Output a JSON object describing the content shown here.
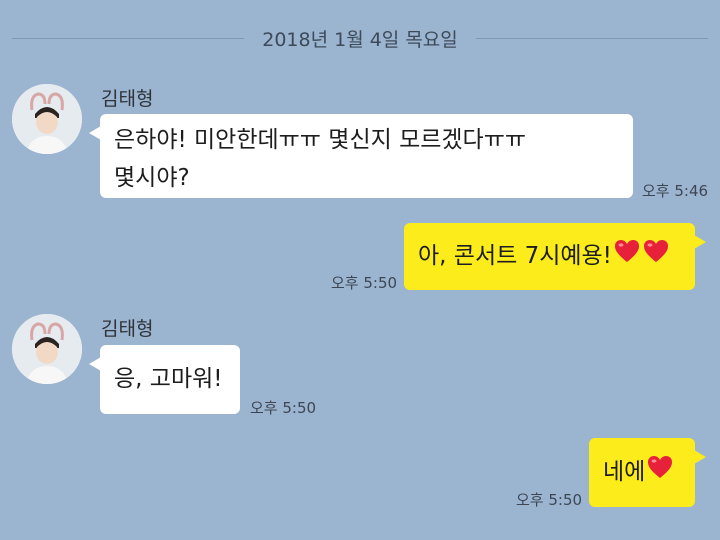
{
  "date_divider": "2018년 1월 4일 목요일",
  "messages": [
    {
      "sender": "김태형",
      "line1": "은하야! 미안한데ㅠㅠ 몇신지 모르겠다ㅠㅠ",
      "line2": "몇시야?",
      "time": "오후 5:46"
    },
    {
      "text": "아, 콘서트 7시예용!",
      "hearts": 2,
      "time": "오후 5:50"
    },
    {
      "sender": "김태형",
      "text": "응, 고마워!",
      "time": "오후 5:50"
    },
    {
      "text": "네에",
      "hearts": 1,
      "time": "오후 5:50"
    }
  ],
  "colors": {
    "background": "#9bb4d0",
    "incoming_bubble": "#ffffff",
    "outgoing_bubble": "#fcec1c",
    "heart": "#e8213a"
  },
  "icons": [
    "heart-emoji-icon",
    "profile-photo"
  ]
}
